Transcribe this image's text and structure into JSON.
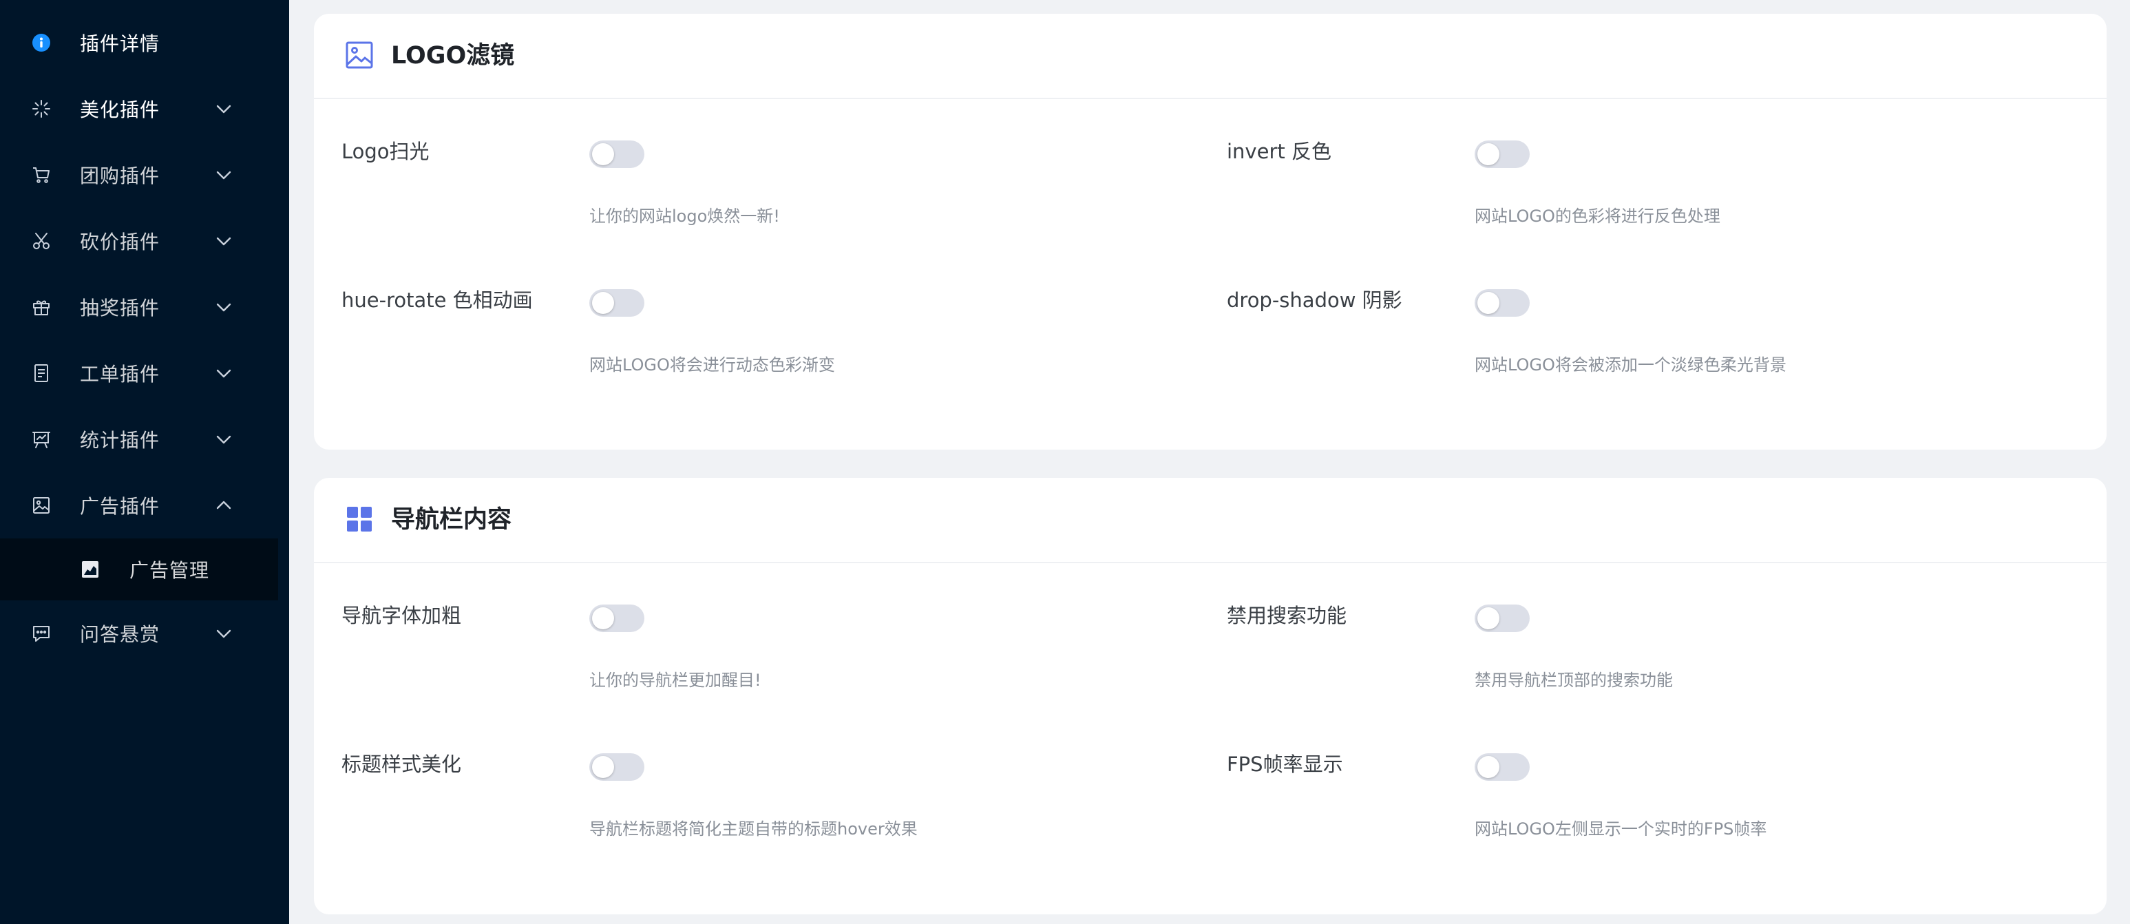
{
  "sidebar": {
    "items": [
      {
        "label": "插件详情",
        "icon": "info-icon"
      },
      {
        "label": "美化插件",
        "icon": "sparkle-icon"
      },
      {
        "label": "团购插件",
        "icon": "cart-icon"
      },
      {
        "label": "砍价插件",
        "icon": "scissors-icon"
      },
      {
        "label": "抽奖插件",
        "icon": "gift-icon"
      },
      {
        "label": "工单插件",
        "icon": "document-icon"
      },
      {
        "label": "统计插件",
        "icon": "presentation-icon"
      },
      {
        "label": "广告插件",
        "icon": "picture-icon"
      },
      {
        "label": "问答悬赏",
        "icon": "message-icon"
      }
    ],
    "sub_items": [
      {
        "label": "广告管理",
        "icon": "area-chart-icon"
      }
    ]
  },
  "sections": [
    {
      "title": "LOGO滤镜",
      "icon": "image-icon",
      "options": [
        {
          "label": "Logo扫光",
          "desc": "让你的网站logo焕然一新!",
          "enabled": false
        },
        {
          "label": "invert 反色",
          "desc": "网站LOGO的色彩将进行反色处理",
          "enabled": false
        },
        {
          "label": "hue-rotate 色相动画",
          "desc": "网站LOGO将会进行动态色彩渐变",
          "enabled": false
        },
        {
          "label": "drop-shadow 阴影",
          "desc": "网站LOGO将会被添加一个淡绿色柔光背景",
          "enabled": false
        }
      ]
    },
    {
      "title": "导航栏内容",
      "icon": "grid-icon",
      "options": [
        {
          "label": "导航字体加粗",
          "desc": "让你的导航栏更加醒目!",
          "enabled": false
        },
        {
          "label": "禁用搜索功能",
          "desc": "禁用导航栏顶部的搜索功能",
          "enabled": false
        },
        {
          "label": "标题样式美化",
          "desc": "导航栏标题将简化主题自带的标题hover效果",
          "enabled": false
        },
        {
          "label": "FPS帧率显示",
          "desc": "网站LOGO左侧显示一个实时的FPS帧率",
          "enabled": false
        }
      ]
    }
  ],
  "colors": {
    "sidebar_bg": "#001529",
    "submenu_bg": "#000c17",
    "accent": "#1890ff",
    "header_icon": "#5b74e8",
    "toggle_off": "#dcdfe8"
  }
}
